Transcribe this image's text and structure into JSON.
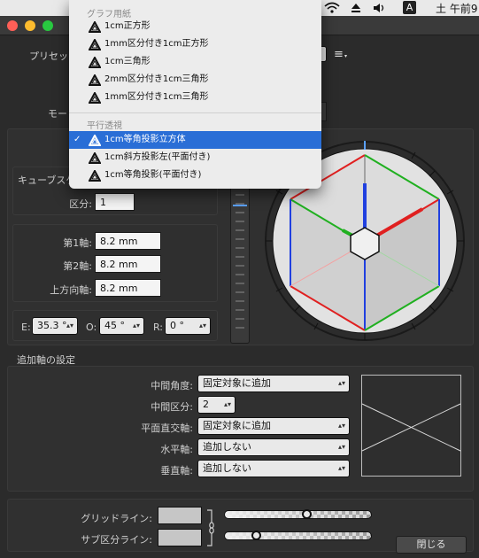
{
  "menubar": {
    "input_indicator": "A",
    "clock": "土 午前9"
  },
  "preset": {
    "label": "プリセット",
    "menu_icon": "≡"
  },
  "mode_label": "モード",
  "dropdown": {
    "group1": "グラフ用紙",
    "group1_items": [
      "1cm正方形",
      "1mm区分付き1cm正方形",
      "1cm三角形",
      "2mm区分付き1cm三角形",
      "1mm区分付き1cm三角形"
    ],
    "group2": "平行透視",
    "group2_items": [
      "1cm等角投影立方体",
      "1cm斜方投影左(平面付き)",
      "1cm等角投影(平面付き)"
    ],
    "selected_index": 0,
    "checkmark": "✓"
  },
  "cube": {
    "title": "キューブスケ",
    "division_label": "区分:",
    "division_value": "1"
  },
  "axes": {
    "axis1_label": "第1軸:",
    "axis1_value": "8.2 mm",
    "axis2_label": "第2軸:",
    "axis2_value": "8.2 mm",
    "up_label": "上方向軸:",
    "up_value": "8.2 mm"
  },
  "angles": {
    "e_label": "E:",
    "e_value": "35.3 °",
    "o_label": "O:",
    "o_value": "45 °",
    "r_label": "R:",
    "r_value": "0 °"
  },
  "extra": {
    "title": "追加軸の設定",
    "mid_angle_label": "中間角度:",
    "mid_angle_value": "固定対象に追加",
    "mid_div_label": "中間区分:",
    "mid_div_value": "2",
    "plane_label": "平面直交軸:",
    "plane_value": "固定対象に追加",
    "horiz_label": "水平軸:",
    "horiz_value": "追加しない",
    "vert_label": "垂直軸:",
    "vert_value": "追加しない"
  },
  "lines": {
    "grid_label": "グリッドライン:",
    "sub_label": "サブ区分ライン:",
    "grid_opacity": 0.56,
    "sub_opacity": 0.19
  },
  "close_button": "閉じる",
  "colors": {
    "axis_x": "#e02020",
    "axis_y": "#20b020",
    "axis_z": "#2040e0",
    "highlight": "#2a6ed6"
  }
}
